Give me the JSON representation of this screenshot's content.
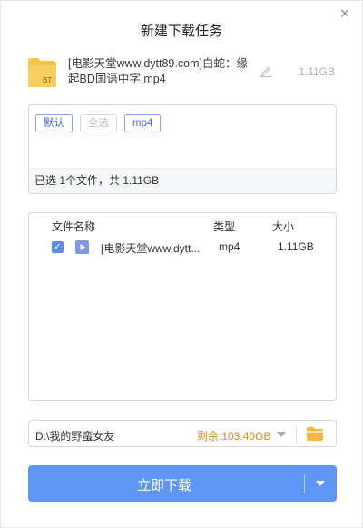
{
  "dialog": {
    "title": "新建下载任务",
    "close_label": "✕"
  },
  "task": {
    "icon_label": "BT",
    "name": "[电影天堂www.dytt89.com]白蛇：缘起BD国语中字.mp4",
    "size": "1.11GB"
  },
  "filters": {
    "chips": [
      "默认",
      "全选",
      "mp4"
    ],
    "selected_summary": "已选 1个文件，共 1.11GB"
  },
  "file_list": {
    "headers": {
      "name": "文件名称",
      "type": "类型",
      "size": "大小"
    },
    "rows": [
      {
        "checked": true,
        "name": "[电影天堂www.dytt...",
        "type": "mp4",
        "size": "1.11GB"
      }
    ]
  },
  "save_path": {
    "path": "D:\\我的野蛮女友",
    "free_space": "剩余:103.40GB"
  },
  "download_button": {
    "label": "立即下载"
  },
  "colors": {
    "accent": "#5f95f5",
    "chip_active": "#3d6fe0",
    "free_space": "#d98c1b",
    "folder": "#f3b73f"
  }
}
